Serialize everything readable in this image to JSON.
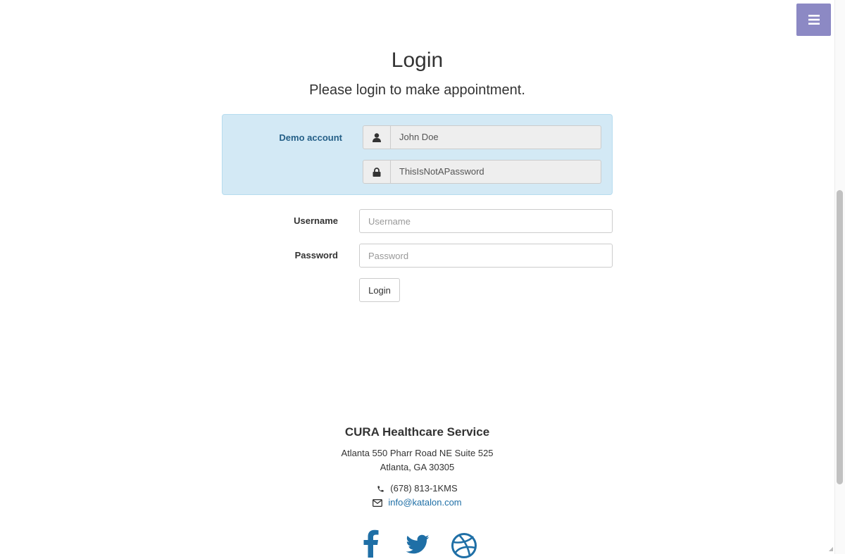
{
  "header": {
    "menu_icon": "bars-icon",
    "menu_color": "#8c89c4"
  },
  "login": {
    "title": "Login",
    "subtitle": "Please login to make appointment."
  },
  "demo": {
    "label": "Demo account",
    "username_value": "John Doe",
    "username_icon": "user-icon",
    "password_value": "ThisIsNotAPassword",
    "password_icon": "lock-icon",
    "box_color": "#d3e9f5",
    "label_color": "#245f87"
  },
  "form": {
    "username_label": "Username",
    "username_placeholder": "Username",
    "password_label": "Password",
    "password_placeholder": "Password",
    "login_button": "Login"
  },
  "footer": {
    "company": "CURA Healthcare Service",
    "address_line1": "Atlanta 550 Pharr Road NE Suite 525",
    "address_line2": "Atlanta, GA 30305",
    "phone": "(678) 813-1KMS",
    "phone_icon": "phone-icon",
    "email": "info@katalon.com",
    "email_icon": "envelope-icon",
    "link_color": "#1f6fa6",
    "social": [
      "facebook-icon",
      "twitter-icon",
      "dribbble-icon"
    ]
  }
}
